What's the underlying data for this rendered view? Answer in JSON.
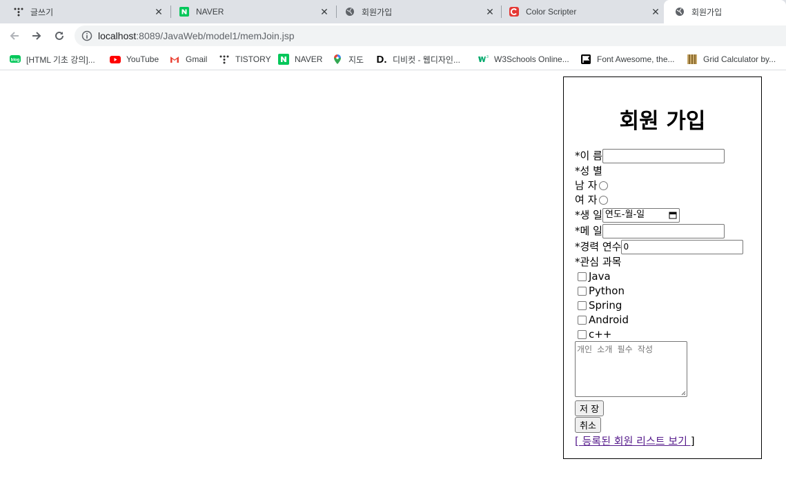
{
  "browser": {
    "tabs": [
      {
        "title": "글쓰기",
        "icon": "tistory-icon"
      },
      {
        "title": "NAVER",
        "icon": "naver-icon"
      },
      {
        "title": "회원가입",
        "icon": "globe-icon"
      },
      {
        "title": "Color Scripter",
        "icon": "colorscripter-icon"
      },
      {
        "title": "회원가입",
        "icon": "globe-icon",
        "active": true
      }
    ],
    "url_host": "localhost",
    "url_rest": ":8089/JavaWeb/model1/memJoin.jsp",
    "bookmarks": [
      {
        "label": "[HTML 기초 강의]...",
        "icon": "blog-icon"
      },
      {
        "label": "YouTube",
        "icon": "youtube-icon"
      },
      {
        "label": "Gmail",
        "icon": "gmail-icon"
      },
      {
        "label": "TISTORY",
        "icon": "tistory-icon"
      },
      {
        "label": "NAVER",
        "icon": "naver-icon"
      },
      {
        "label": "지도",
        "icon": "maps-icon"
      },
      {
        "label": "디비컷 - 웹디자인...",
        "icon": "dbcut-icon"
      },
      {
        "label": "W3Schools Online...",
        "icon": "w3schools-icon"
      },
      {
        "label": "Font Awesome, the...",
        "icon": "fontawesome-icon"
      },
      {
        "label": "Grid Calculator by...",
        "icon": "grid-calculator-icon"
      }
    ]
  },
  "form": {
    "title": "회원 가입",
    "name_label": "*이 름",
    "gender_label": "*성 별",
    "male_label": "남 자",
    "female_label": "여 자",
    "birth_label": "*생 일",
    "birth_placeholder": "연도-월-일",
    "email_label": "*메 일",
    "career_label": "*경력 연수",
    "career_value": "0",
    "interest_label": "*관심 과목",
    "interests": [
      "Java",
      "Python",
      "Spring",
      "Android",
      "c++"
    ],
    "intro_placeholder": "개인 소개 필수 작성",
    "save_button": "저 장",
    "cancel_button": "취소",
    "list_link_open": "[",
    "list_link": " 등록된 회원 리스트 보기 ",
    "list_link_close": "]"
  },
  "colors": {
    "tabstrip_bg": "#dee1e6",
    "link_visited": "#551a8b",
    "naver_green": "#03c75a"
  }
}
